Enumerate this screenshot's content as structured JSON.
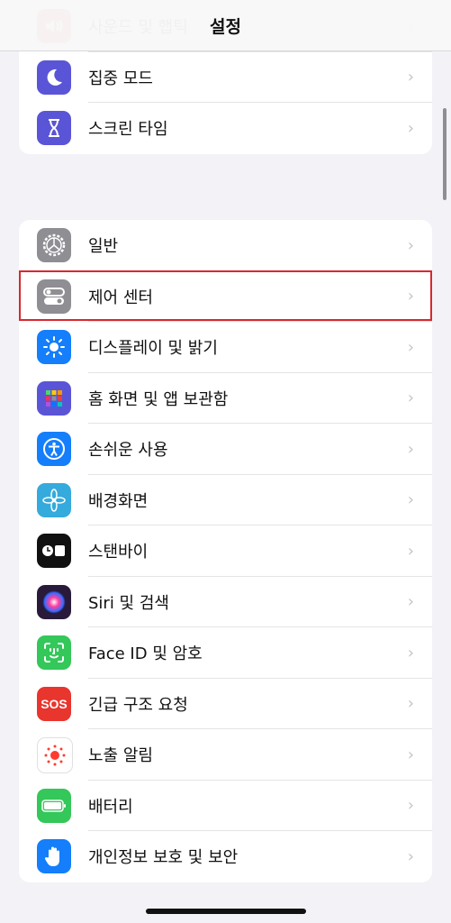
{
  "header": {
    "title": "설정"
  },
  "group1": [
    {
      "label": "사운드 및 햅틱",
      "icon": "speaker-icon",
      "color": "#f0344f"
    },
    {
      "label": "집중 모드",
      "icon": "moon-icon",
      "color": "#5a55d6"
    },
    {
      "label": "스크린 타임",
      "icon": "hourglass-icon",
      "color": "#5a55d6"
    }
  ],
  "group2": [
    {
      "label": "일반",
      "icon": "gear-icon",
      "color": "#8e8e93"
    },
    {
      "label": "제어 센터",
      "icon": "toggles-icon",
      "color": "#8e8e93"
    },
    {
      "label": "디스플레이 및 밝기",
      "icon": "sun-icon",
      "color": "#147efb"
    },
    {
      "label": "홈 화면 및 앱 보관함",
      "icon": "app-grid-icon",
      "color": "#5a55d6"
    },
    {
      "label": "손쉬운 사용",
      "icon": "accessibility-icon",
      "color": "#147efb"
    },
    {
      "label": "배경화면",
      "icon": "flower-icon",
      "color": "#35aadc"
    },
    {
      "label": "스탠바이",
      "icon": "standby-icon",
      "color": "#111111"
    },
    {
      "label": "Siri 및 검색",
      "icon": "siri-icon",
      "color": "#2a1a3a"
    },
    {
      "label": "Face ID 및 암호",
      "icon": "face-id-icon",
      "color": "#34c759"
    },
    {
      "label": "긴급 구조 요청",
      "icon": "sos-icon",
      "color": "#e8352d"
    },
    {
      "label": "노출 알림",
      "icon": "exposure-icon",
      "color": "#ffffff"
    },
    {
      "label": "배터리",
      "icon": "battery-icon",
      "color": "#34c759"
    },
    {
      "label": "개인정보 보호 및 보안",
      "icon": "hand-icon",
      "color": "#147efb"
    }
  ],
  "sos_text": "SOS",
  "highlighted": "제어 센터",
  "highlight_color": "#d8282f"
}
